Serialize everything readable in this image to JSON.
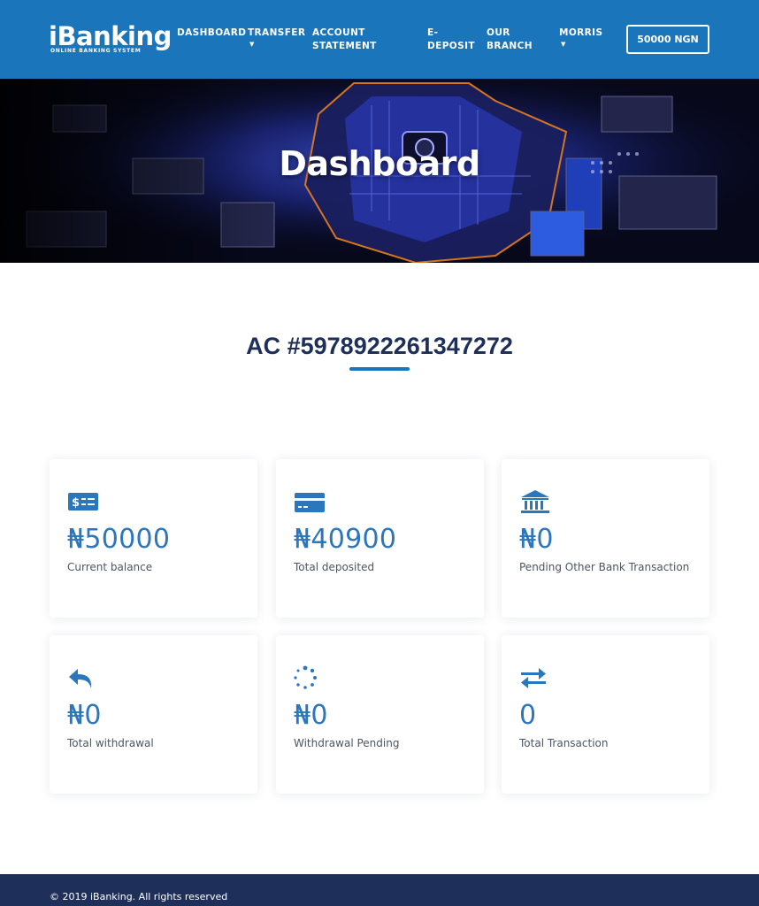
{
  "brand": {
    "name": "iBanking",
    "tagline": "ONLINE BANKING SYSTEM"
  },
  "nav": {
    "items": [
      {
        "label": "DASHBOARD",
        "dropdown": false
      },
      {
        "label": "TRANSFER",
        "dropdown": true
      },
      {
        "label": "ACCOUNT STATEMENT",
        "dropdown": false
      },
      {
        "label": "E-DEPOSIT",
        "dropdown": false
      },
      {
        "label": "OUR BRANCH",
        "dropdown": false
      },
      {
        "label": "MORRIS",
        "dropdown": true
      }
    ],
    "balance_button": "50000 NGN"
  },
  "hero": {
    "title": "Dashboard"
  },
  "account": {
    "heading": "AC #5978922261347272"
  },
  "stats": [
    {
      "icon": "money-bill-icon",
      "value": "₦50000",
      "label": "Current balance"
    },
    {
      "icon": "credit-card-icon",
      "value": "₦40900",
      "label": "Total deposited"
    },
    {
      "icon": "bank-icon",
      "value": "₦0",
      "label": "Pending Other Bank Transaction"
    },
    {
      "icon": "reply-arrow-icon",
      "value": "₦0",
      "label": "Total withdrawal"
    },
    {
      "icon": "spinner-icon",
      "value": "₦0",
      "label": "Withdrawal Pending"
    },
    {
      "icon": "exchange-icon",
      "value": "0",
      "label": "Total Transaction"
    }
  ],
  "footer": {
    "copyright": "© 2019 iBanking. All rights reserved"
  },
  "colors": {
    "header_bg": "#1a75bb",
    "accent": "#2a77bd",
    "heading_dark": "#1e2f59",
    "footer_bg": "#1e2f59"
  }
}
